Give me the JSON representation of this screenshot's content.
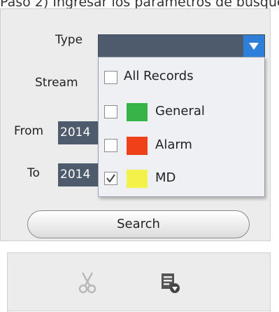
{
  "doc_heading": "Paso 2) Ingresar los parámetros de búsqueda",
  "form": {
    "type_label": "Type",
    "stream_label": "Stream",
    "from_label": "From",
    "from_value": "2014",
    "to_label": "To",
    "to_value": "2014"
  },
  "type_menu": {
    "items": [
      {
        "label": "All Records",
        "checked": false,
        "color": null
      },
      {
        "label": "General",
        "checked": false,
        "color": "#37b34a"
      },
      {
        "label": "Alarm",
        "checked": false,
        "color": "#f0401a"
      },
      {
        "label": "MD",
        "checked": true,
        "color": "#f2f24a"
      }
    ]
  },
  "search_label": "Search",
  "toolbar": {
    "cut_icon": "scissors-icon",
    "export_icon": "export-list-icon"
  },
  "colors": {
    "field_bg": "#4e5b6d",
    "dropdown_button": "#2d7fd8",
    "panel_bg": "#ececec"
  }
}
